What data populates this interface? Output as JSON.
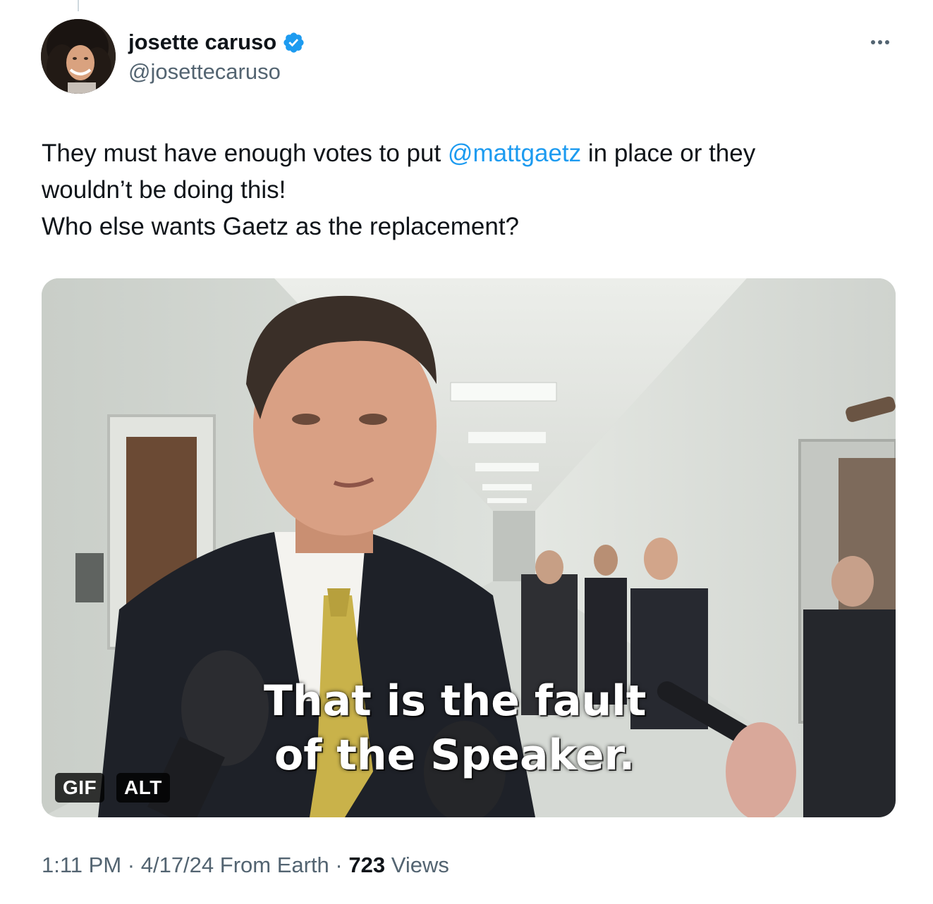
{
  "author": {
    "display_name": "josette caruso",
    "handle": "@josettecaruso",
    "verified": true,
    "avatar_icon": "profile-photo"
  },
  "tweet": {
    "text_part1": "They must have enough votes to put ",
    "mention": "@mattgaetz",
    "text_part2": " in place or they",
    "text_line2": "wouldn’t be doing this!",
    "text_line3": "Who else wants Gaetz as the replacement?"
  },
  "media": {
    "caption_line1": "That is the fault",
    "caption_line2": "of the Speaker.",
    "gif_badge": "GIF",
    "alt_badge": "ALT"
  },
  "meta": {
    "time": "1:11 PM",
    "sep1": " · ",
    "date": "4/17/24",
    "source": " From Earth",
    "sep2": " · ",
    "views_count": "723",
    "views_label": " Views"
  },
  "colors": {
    "link": "#1d9bf0",
    "secondary_text": "#536471",
    "primary_text": "#0f1419",
    "verified": "#1d9bf0"
  },
  "icons": {
    "verified": "verified-badge-icon",
    "more": "more-options-icon"
  }
}
